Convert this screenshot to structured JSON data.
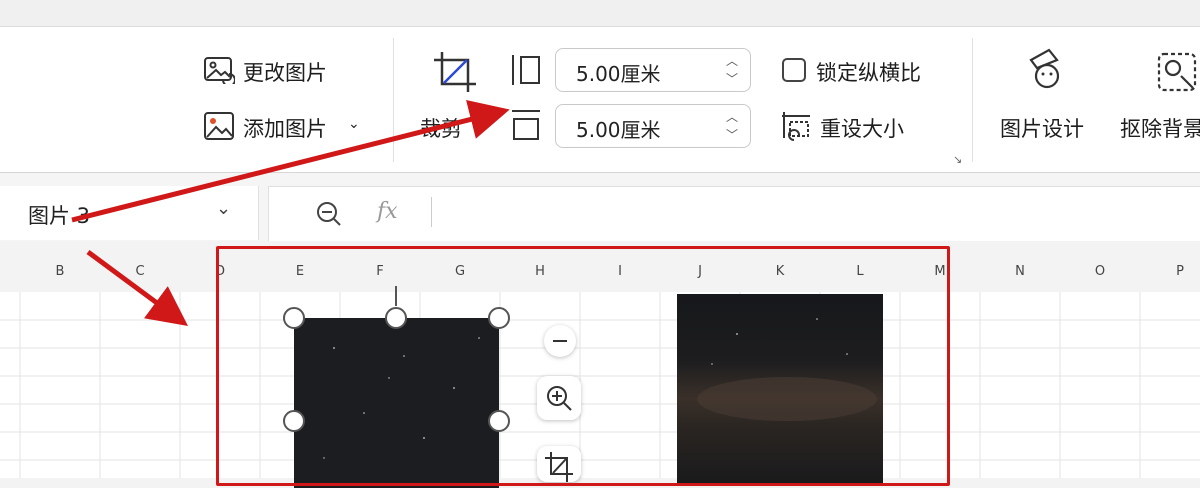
{
  "ribbon": {
    "change_picture": "更改图片",
    "add_picture": "添加图片",
    "crop": "裁剪",
    "width_value": "5.00厘米",
    "height_value": "5.00厘米",
    "lock_aspect": "锁定纵横比",
    "reset_size": "重设大小",
    "picture_design": "图片设计",
    "remove_bg": "抠除背景"
  },
  "formula_bar": {
    "name_box": "图片 3",
    "fx": "fx"
  },
  "sheet": {
    "columns": [
      "B",
      "C",
      "D",
      "E",
      "F",
      "G",
      "H",
      "I",
      "J",
      "K",
      "L",
      "M",
      "N",
      "O",
      "P"
    ]
  },
  "colors": {
    "annotation_red": "#d01818",
    "accent": "#1f1f1f"
  }
}
